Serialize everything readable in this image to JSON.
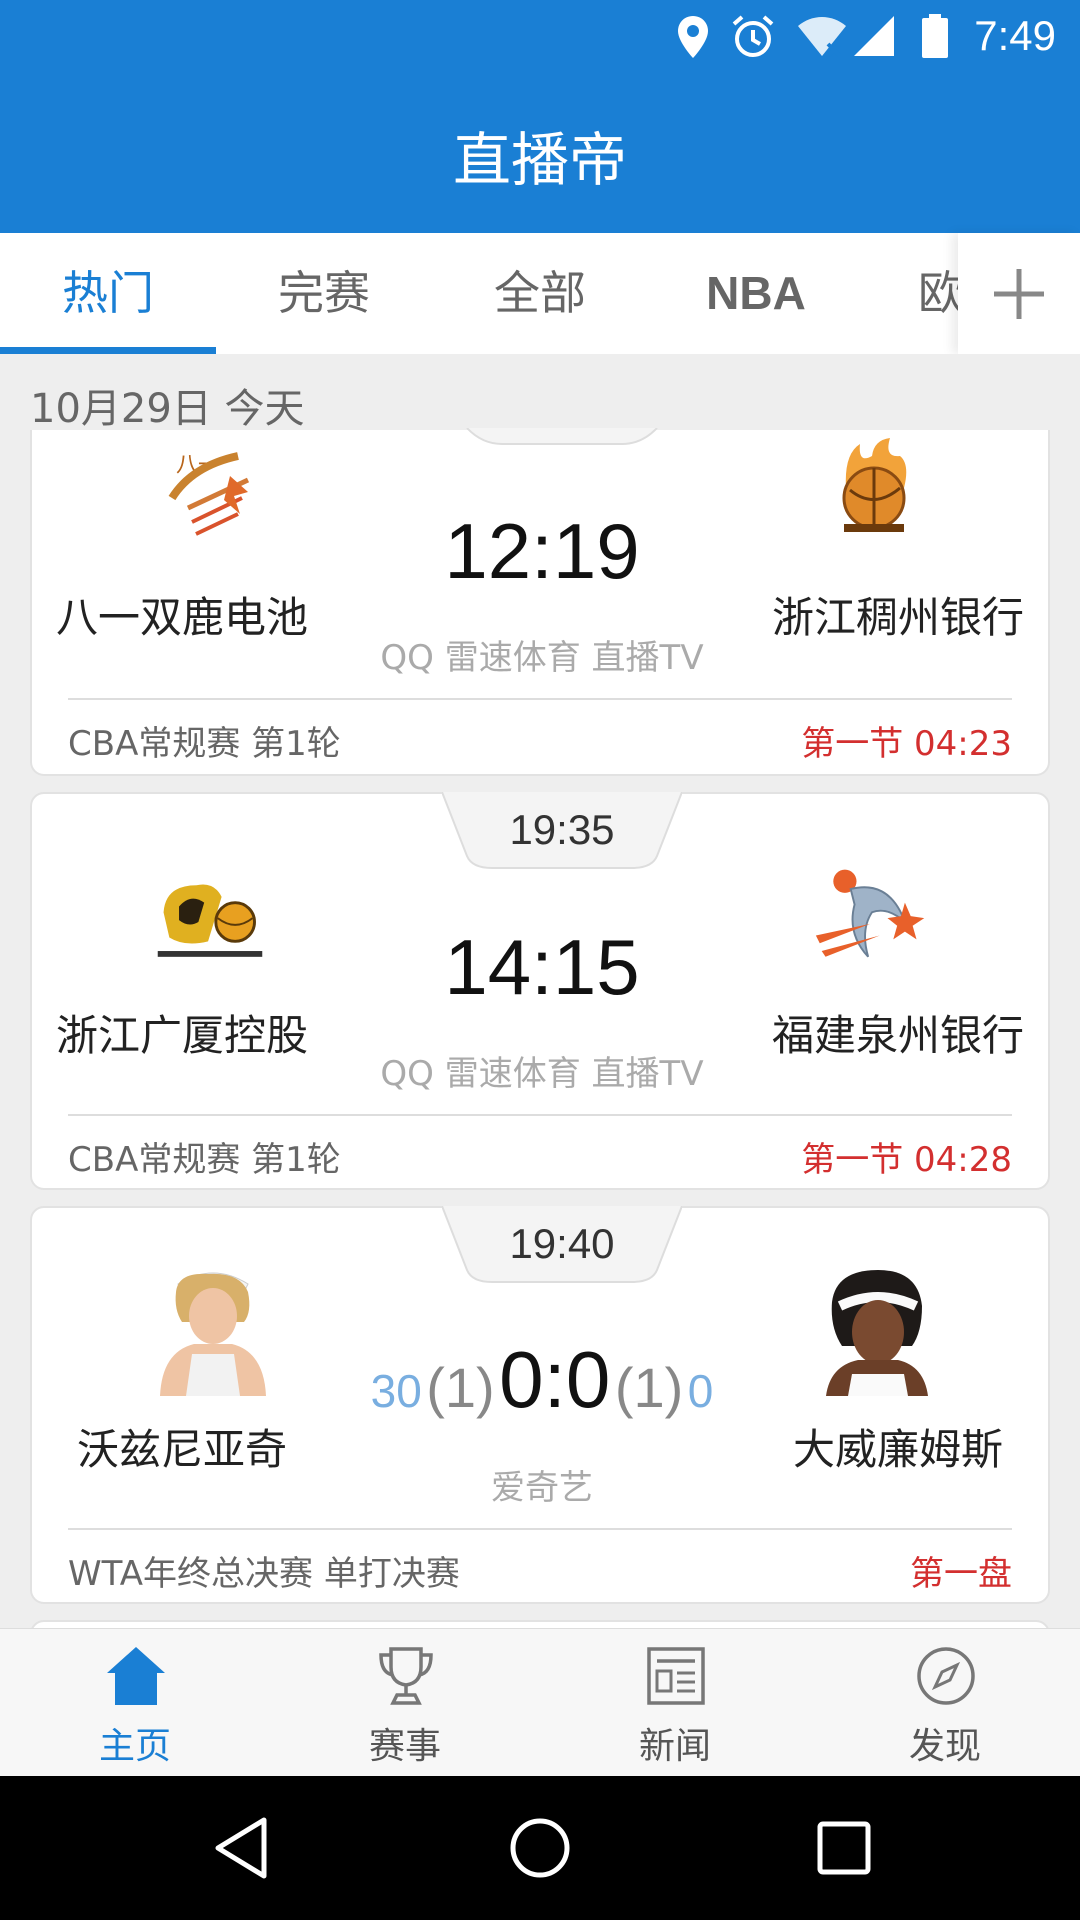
{
  "status_bar": {
    "time": "7:49",
    "icons": [
      "location-icon",
      "alarm-icon",
      "wifi-off-icon",
      "signal-icon",
      "battery-icon"
    ]
  },
  "app": {
    "title": "直播帝"
  },
  "tabs": [
    {
      "label": "热门",
      "active": true
    },
    {
      "label": "完赛"
    },
    {
      "label": "全部"
    },
    {
      "label": "NBA"
    },
    {
      "label": "欧"
    }
  ],
  "date_header": "10月29日 今天",
  "matches": [
    {
      "home_team": "八一双鹿电池",
      "away_team": "浙江稠州银行",
      "score": "12:19",
      "channels": "QQ 雷速体育 直播TV",
      "league": "CBA常规赛 第1轮",
      "status": "第一节 04:23"
    },
    {
      "start_time": "19:35",
      "home_team": "浙江广厦控股",
      "away_team": "福建泉州银行",
      "score": "14:15",
      "channels": "QQ 雷速体育 直播TV",
      "league": "CBA常规赛 第1轮",
      "status": "第一节 04:28"
    },
    {
      "start_time": "19:40",
      "home_team": "沃兹尼亚奇",
      "away_team": "大威廉姆斯",
      "home_points": "30",
      "home_sets": "(1)",
      "score": "0:0",
      "away_sets": "(1)",
      "away_points": "0",
      "channels": "爱奇艺",
      "league": "WTA年终总决赛 单打决赛",
      "status": "第一盘"
    }
  ],
  "bottom_nav": [
    {
      "label": "主页",
      "icon": "home-icon",
      "active": true
    },
    {
      "label": "赛事",
      "icon": "trophy-icon"
    },
    {
      "label": "新闻",
      "icon": "news-icon"
    },
    {
      "label": "发现",
      "icon": "compass-icon"
    }
  ],
  "system_nav": [
    "back-icon",
    "home-circle-icon",
    "recents-icon"
  ],
  "colors": {
    "primary": "#1a7fd4",
    "live_status": "#d32f2f",
    "point_score": "#79aee0"
  }
}
